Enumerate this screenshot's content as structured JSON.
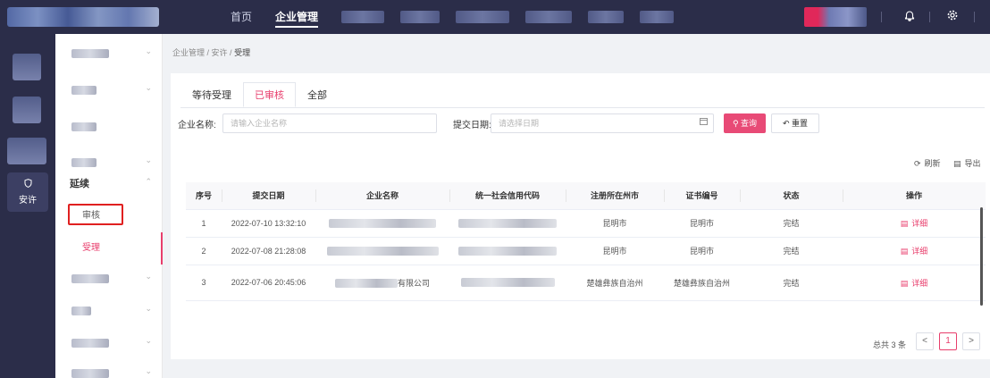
{
  "topbar": {
    "nav": [
      "首页",
      "企业管理"
    ],
    "active_nav": "企业管理",
    "icons": [
      "bell-icon",
      "gear-icon"
    ]
  },
  "rail": {
    "active_label": "安许",
    "active_icon": "shield-icon"
  },
  "submenu": {
    "section_label": "延续",
    "items": [
      "审核",
      "受理"
    ],
    "active_item": "受理"
  },
  "breadcrumb": {
    "parts": [
      "企业管理",
      "安许"
    ],
    "current": "受理",
    "sep": " / "
  },
  "tabs": [
    "等待受理",
    "已审核",
    "全部"
  ],
  "active_tab": "已审核",
  "filters": {
    "company_label": "企业名称:",
    "company_placeholder": "请输入企业名称",
    "date_label": "提交日期:",
    "date_placeholder": "请选择日期",
    "query_label": "查询",
    "reset_label": "重置"
  },
  "toolbar": {
    "refresh_label": "刷新",
    "export_label": "导出"
  },
  "table": {
    "columns": [
      "序号",
      "提交日期",
      "企业名称",
      "统一社会信用代码",
      "注册所在州市",
      "证书编号",
      "状态",
      "操作"
    ],
    "rows": [
      {
        "no": "1",
        "date": "2022-07-10 13:32:10",
        "company": "",
        "code": "",
        "city": "昆明市",
        "cert": "昆明市",
        "status": "完结",
        "action": "详细"
      },
      {
        "no": "2",
        "date": "2022-07-08 21:28:08",
        "company": "",
        "code": "",
        "city": "昆明市",
        "cert": "昆明市",
        "status": "完结",
        "action": "详细"
      },
      {
        "no": "3",
        "date": "2022-07-06 20:45:06",
        "company": "有限公司",
        "code": "",
        "city": "楚雄彝族自治州",
        "cert": "楚雄彝族自治州",
        "status": "完结",
        "action": "详细"
      }
    ]
  },
  "pagination": {
    "total_text": "总共 3 条",
    "current_page": "1",
    "prev": "<",
    "next": ">"
  },
  "colors": {
    "accent": "#e83e6c",
    "sidebar_bg": "#2b2d49",
    "highlight_box": "#e02020"
  }
}
